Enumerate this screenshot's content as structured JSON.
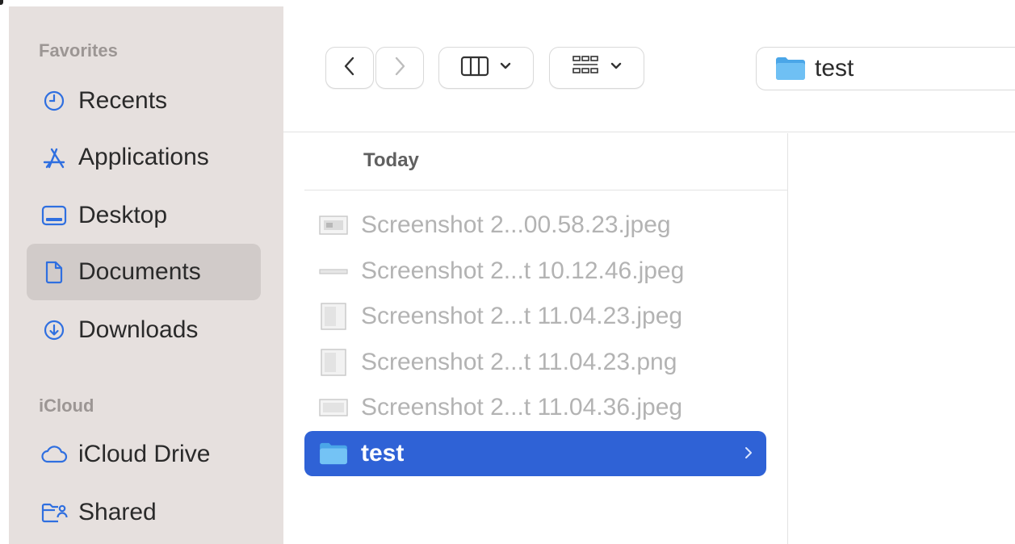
{
  "sidebar": {
    "favorites_header": "Favorites",
    "favorites": [
      {
        "label": "Recents",
        "icon": "clock-icon"
      },
      {
        "label": "Applications",
        "icon": "applications-icon"
      },
      {
        "label": "Desktop",
        "icon": "desktop-icon"
      },
      {
        "label": "Documents",
        "icon": "document-icon",
        "selected": true
      },
      {
        "label": "Downloads",
        "icon": "download-icon"
      }
    ],
    "icloud_header": "iCloud",
    "icloud": [
      {
        "label": "iCloud Drive",
        "icon": "cloud-icon"
      },
      {
        "label": "Shared",
        "icon": "shared-folder-icon"
      }
    ]
  },
  "toolbar": {
    "back": "back-chevron-icon",
    "forward": "forward-chevron-icon",
    "view_mode": "columns-view-icon",
    "group": "group-grid-icon",
    "path_label": "test"
  },
  "browser": {
    "group_header": "Today",
    "files": [
      {
        "name": "Screenshot 2...00.58.23.jpeg",
        "icon": "image-thumbnail-icon"
      },
      {
        "name": "Screenshot 2...t 10.12.46.jpeg",
        "icon": "image-thumbnail-icon"
      },
      {
        "name": "Screenshot 2...t 11.04.23.jpeg",
        "icon": "image-thumbnail-icon"
      },
      {
        "name": "Screenshot 2...t 11.04.23.png",
        "icon": "image-thumbnail-icon"
      },
      {
        "name": "Screenshot 2...t 11.04.36.jpeg",
        "icon": "image-thumbnail-icon"
      },
      {
        "name": "test",
        "icon": "folder-icon",
        "selected": true
      }
    ]
  },
  "colors": {
    "accent": "#2f62d6",
    "icon_blue": "#2f6fe0",
    "sidebar_bg": "#e6e0de",
    "folder_blue": "#5ab4f0"
  }
}
